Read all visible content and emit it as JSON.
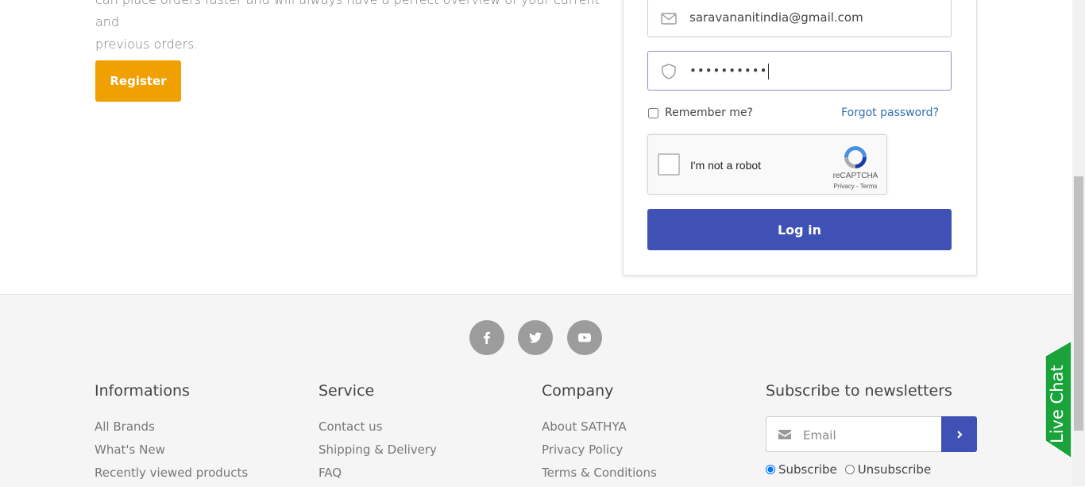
{
  "intro": {
    "line1": "can place orders faster and will always have a perfect overview of your current and",
    "line2": "previous orders."
  },
  "register_label": "Register",
  "login": {
    "email_value": "saravananitindia@gmail.com",
    "password_value": "••••••••••",
    "remember_label": "Remember me?",
    "forgot_label": "Forgot password?",
    "captcha_label": "I'm not a robot",
    "captcha_brand": "reCAPTCHA",
    "captcha_links": "Privacy - Terms",
    "login_label": "Log in"
  },
  "footer": {
    "social": [
      "facebook-icon",
      "twitter-icon",
      "youtube-icon"
    ],
    "columns": [
      {
        "title": "Informations",
        "links": [
          "All Brands",
          "What's New",
          "Recently viewed products"
        ]
      },
      {
        "title": "Service",
        "links": [
          "Contact us",
          "Shipping & Delivery",
          "FAQ"
        ]
      },
      {
        "title": "Company",
        "links": [
          "About SATHYA",
          "Privacy Policy",
          "Terms & Conditions"
        ]
      }
    ],
    "newsletter": {
      "title": "Subscribe to newsletters",
      "placeholder": "Email",
      "subscribe_label": "Subscribe",
      "unsubscribe_label": "Unsubscribe",
      "selected": "Subscribe"
    }
  },
  "livechat_label": "Live Chat",
  "colors": {
    "register": "#f0a000",
    "primary": "#3f51b5",
    "livechat": "#1aa33a",
    "link": "#2f6fb0"
  }
}
